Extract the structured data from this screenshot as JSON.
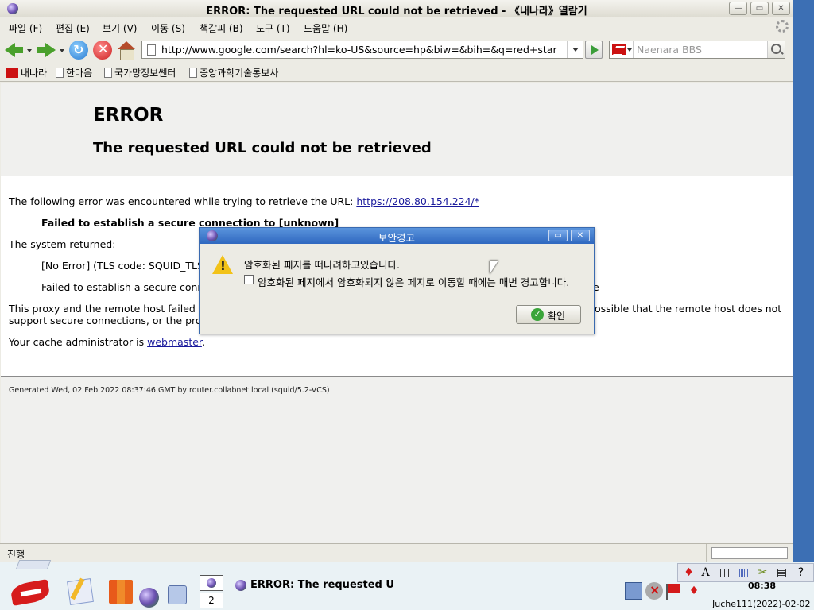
{
  "window": {
    "title": "ERROR: The requested URL could not be retrieved - 《내나라》열람기"
  },
  "menu": [
    {
      "label": "파일 (F)"
    },
    {
      "label": "편집 (E)"
    },
    {
      "label": "보기 (V)"
    },
    {
      "label": "이동 (S)"
    },
    {
      "label": "책갈피 (B)"
    },
    {
      "label": "도구 (T)"
    },
    {
      "label": "도움말 (H)"
    }
  ],
  "navbar": {
    "url": "http://www.google.com/search?hl=ko-US&source=hp&biw=&bih=&q=red+star",
    "search_placeholder": "Naenara BBS"
  },
  "bookmarks": [
    {
      "label": "내나라",
      "icon": "naenara-flag-icon"
    },
    {
      "label": "한마음",
      "icon": "page-icon"
    },
    {
      "label": "국가망정보쎈터",
      "icon": "page-icon"
    },
    {
      "label": "중앙과학기술통보사",
      "icon": "page-icon"
    }
  ],
  "page": {
    "h1": "ERROR",
    "h2": "The requested URL could not be retrieved",
    "line1_prefix": "The following error was encountered while trying to retrieve the URL: ",
    "line1_link": "https://208.80.154.224/*",
    "line2": "Failed to establish a secure connection to [unknown]",
    "line3": "The system returned:",
    "line4": "[No Error] (TLS code: SQUID_TLS",
    "line5": "Failed to establish a secure conn",
    "line5_tail": "e",
    "line6a": "This proxy and the remote host failed to",
    "line6b": "ossible that the remote host does not",
    "line7": "support secure connections, or the pro",
    "line8_prefix": "Your cache administrator is ",
    "line8_link": "webmaster",
    "line8_suffix": ".",
    "footer": "Generated Wed, 02 Feb 2022 08:37:46 GMT by router.collabnet.local (squid/5.2-VCS)"
  },
  "status": {
    "text": "진행"
  },
  "dialog": {
    "title": "보안경고",
    "message": "암호화된 페지를 떠나려하고있습니다.",
    "checkbox_label": "암호화된 페지에서 암호화되지 않은 페지로 이동할 때에는 매번 경고합니다.",
    "checkbox_checked": false,
    "ok_label": "확인"
  },
  "taskbar": {
    "workspace_2": "2",
    "task_title": "ERROR: The requested URL could not be retrieved",
    "clock": "08:38",
    "date": "Juche111(2022)-02-02"
  }
}
